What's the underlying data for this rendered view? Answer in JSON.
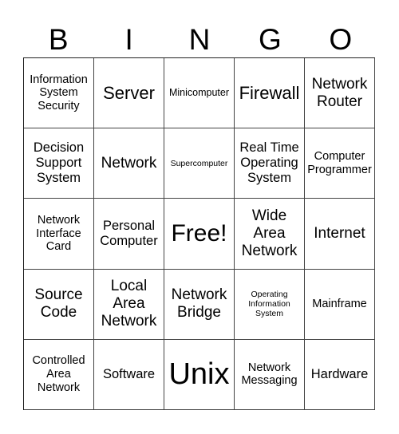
{
  "header": {
    "letters": [
      "B",
      "I",
      "N",
      "G",
      "O"
    ]
  },
  "cells": [
    "Information System Security",
    "Server",
    "Minicomputer",
    "Firewall",
    "Network Router",
    "Decision Support System",
    "Network",
    "Supercomputer",
    "Real Time Operating System",
    "Computer Programmer",
    "Network Interface Card",
    "Personal Computer",
    "Free!",
    "Wide Area Network",
    "Internet",
    "Source Code",
    "Local Area Network",
    "Network Bridge",
    "Operating Information System",
    "Mainframe",
    "Controlled Area Network",
    "Software",
    "Unix",
    "Network Messaging",
    "Hardware"
  ]
}
